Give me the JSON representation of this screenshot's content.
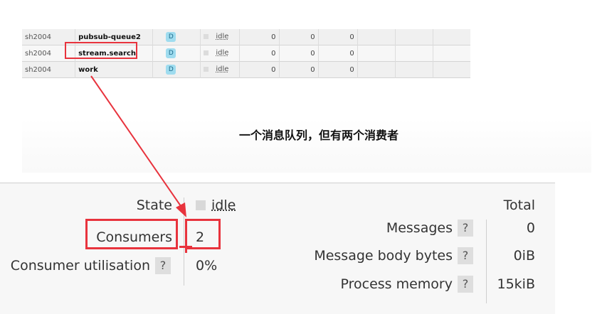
{
  "queue_list": {
    "rows": [
      {
        "vhost": "sh2004",
        "name": "pubsub-queue2",
        "feature": "D",
        "state": "idle",
        "ready": "0",
        "unacked": "0",
        "total": "0"
      },
      {
        "vhost": "sh2004",
        "name": "stream.search",
        "feature": "D",
        "state": "idle",
        "ready": "0",
        "unacked": "0",
        "total": "0"
      },
      {
        "vhost": "sh2004",
        "name": "work",
        "feature": "D",
        "state": "idle",
        "ready": "0",
        "unacked": "0",
        "total": "0"
      }
    ]
  },
  "caption": "一个消息队列，但有两个消费者",
  "details": {
    "state_label": "State",
    "state_value": "idle",
    "consumers_label": "Consumers",
    "consumers_value": "2",
    "utilisation_label": "Consumer utilisation",
    "utilisation_value": "0%",
    "help": "?"
  },
  "totals": {
    "header": "Total",
    "messages_label": "Messages",
    "messages_value": "0",
    "body_bytes_label": "Message body bytes",
    "body_bytes_value": "0iB",
    "memory_label": "Process memory",
    "memory_value": "15kiB"
  },
  "colors": {
    "highlight": "#e8333d",
    "durable_badge": "#9fdcef"
  }
}
